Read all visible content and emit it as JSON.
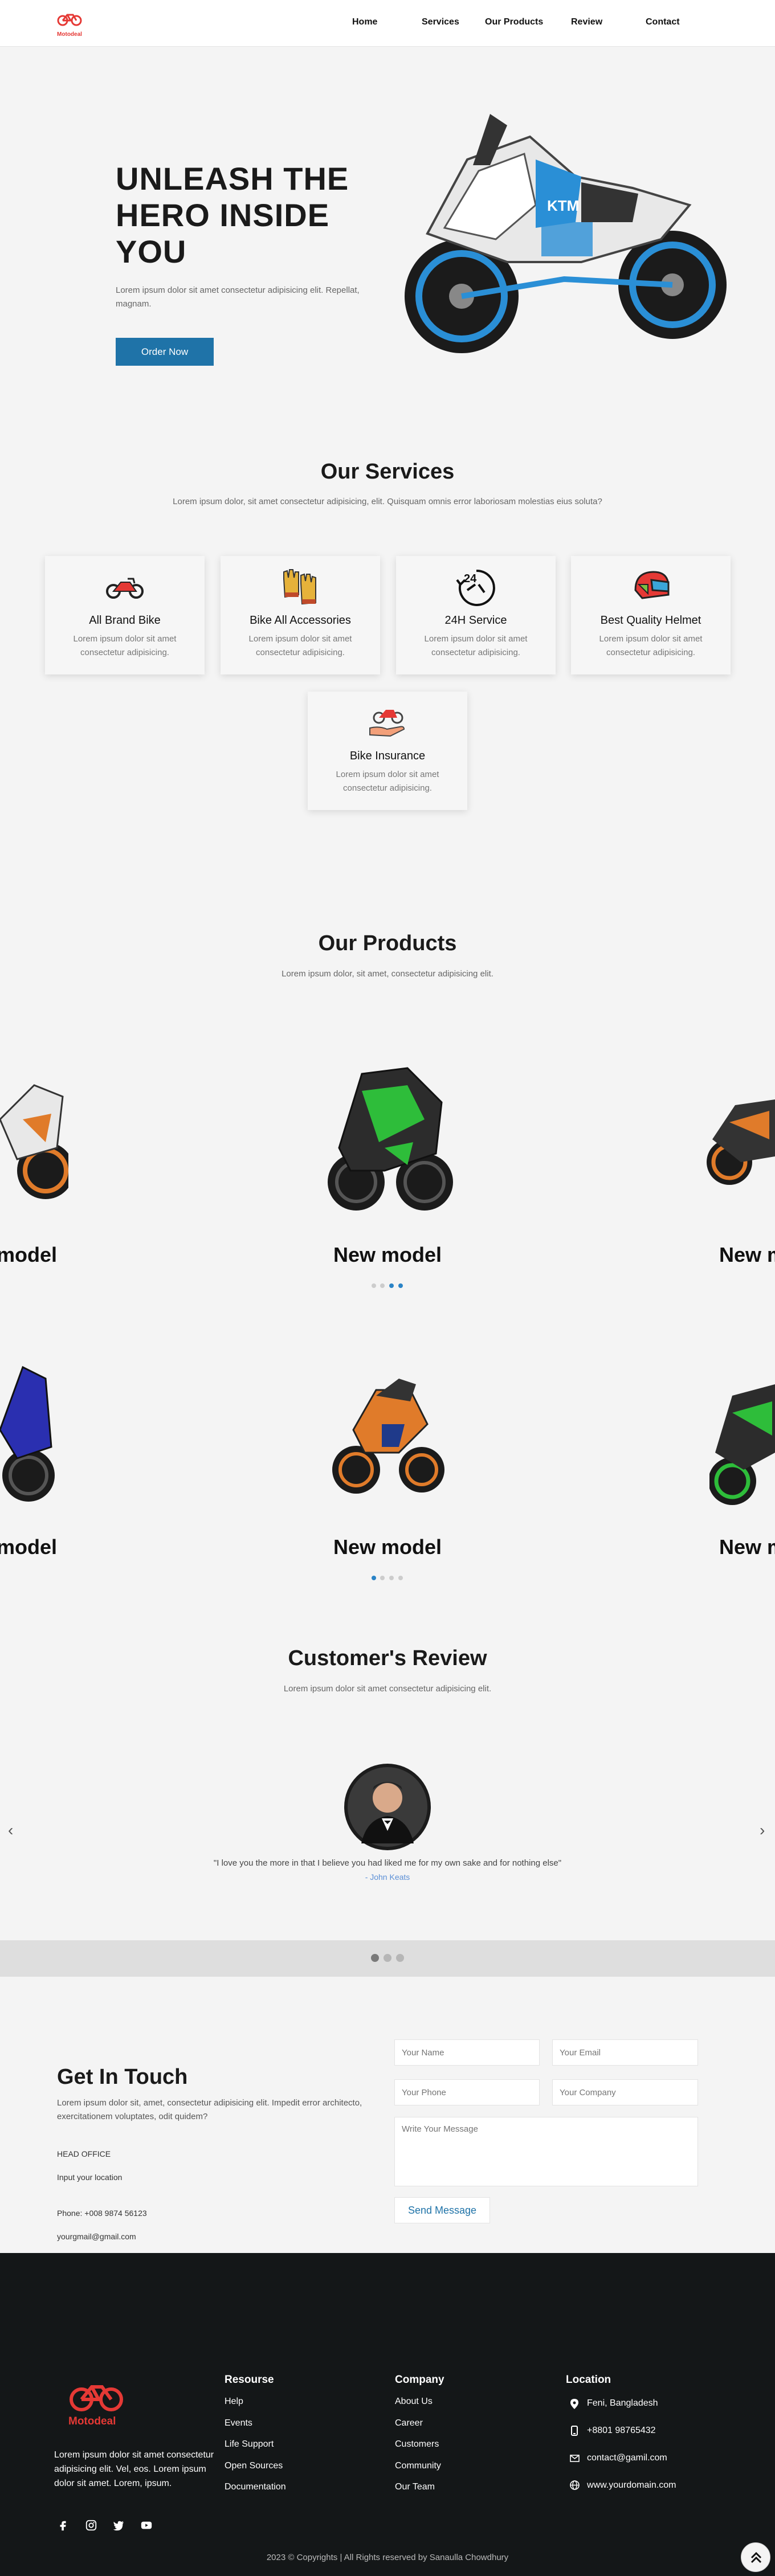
{
  "nav": {
    "brand": "Motodeal",
    "items": [
      "Home",
      "Services",
      "Our Products",
      "Review",
      "Contact"
    ]
  },
  "hero": {
    "title_lines": [
      "UNLEASH THE",
      "HERO INSIDE",
      "YOU"
    ],
    "subtitle": "Lorem ipsum dolor sit amet consectetur adipisicing elit. Repellat, magnam.",
    "button": "Order Now",
    "bike_brand": "KTM"
  },
  "services": {
    "title": "Our Services",
    "subtitle": "Lorem ipsum dolor, sit amet consectetur adipisicing, elit. Quisquam omnis error laboriosam molestias eius soluta?",
    "cards": [
      {
        "title": "All Brand Bike",
        "desc": "Lorem ipsum dolor sit amet consectetur adipisicing.",
        "icon": "motorcycle-icon"
      },
      {
        "title": "Bike All Accessories",
        "desc": "Lorem ipsum dolor sit amet consectetur adipisicing.",
        "icon": "gloves-icon"
      },
      {
        "title": "24H Service",
        "desc": "Lorem ipsum dolor sit amet consectetur adipisicing.",
        "icon": "clock-24h-icon"
      },
      {
        "title": "Best Quality Helmet",
        "desc": "Lorem ipsum dolor sit amet consectetur adipisicing.",
        "icon": "helmet-icon"
      },
      {
        "title": "Bike Insurance",
        "desc": "Lorem ipsum dolor sit amet consectetur adipisicing.",
        "icon": "insurance-icon"
      }
    ]
  },
  "products": {
    "title": "Our Products",
    "subtitle": "Lorem ipsum dolor, sit amet, consectetur adipisicing elit.",
    "label": "New model",
    "row1": [
      "orange-white",
      "green-black",
      "orange-black"
    ],
    "row2": [
      "blue",
      "orange-naked",
      "green"
    ]
  },
  "review": {
    "title": "Customer's Review",
    "subtitle": "Lorem ipsum dolor sit amet consectetur adipisicing elit.",
    "quote": "\"I love you the more in that I believe you had liked me for my own sake and for nothing else\"",
    "author": "- John Keats",
    "prev": "‹",
    "next": "›"
  },
  "contact": {
    "title": "Get In Touch",
    "desc": "Lorem ipsum dolor sit, amet, consectetur adipisicing elit. Impedit error architecto, exercitationem voluptates, odit quidem?",
    "head_office": "HEAD OFFICE",
    "location": "Input your location",
    "phone": "Phone: +008 9874 56123",
    "email": "yourgmail@gmail.com",
    "ph_name": "Your Name",
    "ph_email": "Your Email",
    "ph_phone": "Your Phone",
    "ph_company": "Your Company",
    "ph_message": "Write Your Message",
    "send": "Send Message"
  },
  "footer": {
    "brand": "Motodeal",
    "about": "Lorem ipsum dolor sit amet consectetur adipisicing elit. Vel, eos. Lorem ipsum dolor sit amet. Lorem, ipsum.",
    "resources_title": "Resourse",
    "resources": [
      "Help",
      "Events",
      "Life Support",
      "Open Sources",
      "Documentation"
    ],
    "company_title": "Company",
    "company": [
      "About Us",
      "Career",
      "Customers",
      "Community",
      "Our Team"
    ],
    "location_title": "Location",
    "loc_city": "Feni, Bangladesh",
    "loc_phone": "+8801 98765432",
    "loc_email": "contact@gamil.com",
    "loc_web": "www.yourdomain.com",
    "copyright": "2023 © Copyrights | All Rights reserved by Sanaulla Chowdhury"
  },
  "colors": {
    "accent": "#1f73a8",
    "brand_red": "#e53935",
    "footer_bg": "#141718"
  }
}
